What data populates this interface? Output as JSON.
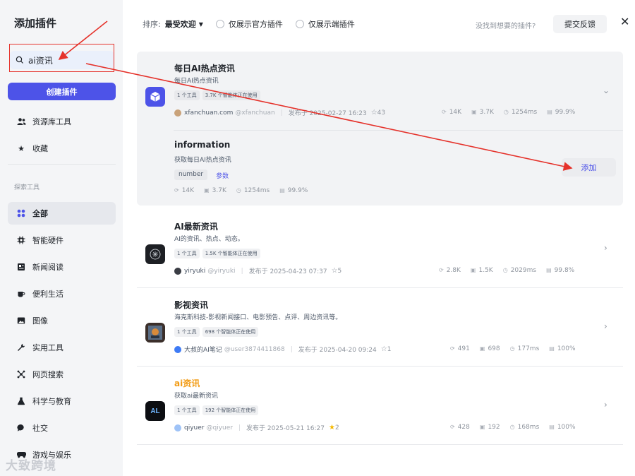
{
  "sidebar": {
    "title": "添加插件",
    "search_value": "ai资讯",
    "create_label": "创建插件",
    "items": [
      {
        "label": "资源库工具",
        "icon": "users-icon"
      },
      {
        "label": "收藏",
        "icon": "star-icon"
      }
    ],
    "section_label": "探索工具",
    "categories": [
      {
        "label": "全部",
        "icon": "grid-icon",
        "active": true
      },
      {
        "label": "智能硬件",
        "icon": "chip-icon"
      },
      {
        "label": "新闻阅读",
        "icon": "news-icon"
      },
      {
        "label": "便利生活",
        "icon": "cup-icon"
      },
      {
        "label": "图像",
        "icon": "image-icon"
      },
      {
        "label": "实用工具",
        "icon": "wrench-icon"
      },
      {
        "label": "网页搜索",
        "icon": "network-icon"
      },
      {
        "label": "科学与教育",
        "icon": "flask-icon"
      },
      {
        "label": "社交",
        "icon": "chat-icon"
      },
      {
        "label": "游戏与娱乐",
        "icon": "gamepad-icon"
      }
    ]
  },
  "watermark": "大致跨境",
  "toolbar": {
    "sort_label": "排序:",
    "sort_value": "最受欢迎",
    "filter_official": "仅展示官方插件",
    "filter_client": "仅展示端插件",
    "no_find_text": "没找到想要的插件?",
    "feedback_label": "提交反馈",
    "close_icon": "close-icon"
  },
  "plugins": [
    {
      "name": "每日AI热点资讯",
      "desc": "每日AI热点资讯",
      "tags": [
        "1 个工具",
        "3.7K 个智能体正在使用"
      ],
      "author": "xfanchuan.com",
      "handle": "@xfanchuan",
      "published": "发布于 2025-02-27 16:23",
      "stars": "43",
      "stats": {
        "calls": "14K",
        "bots": "3.7K",
        "latency": "1254ms",
        "success": "99.9%"
      },
      "tool": {
        "name": "information",
        "desc": "获取每日AI热点资讯",
        "param_tag": "number",
        "param_label": "参数",
        "stats": {
          "calls": "14K",
          "bots": "3.7K",
          "latency": "1254ms",
          "success": "99.9%"
        },
        "add_label": "添加"
      }
    },
    {
      "name": "AI最新资讯",
      "desc": "AI的资讯、热点、动态。",
      "tags": [
        "1 个工具",
        "1.5K 个智能体正在使用"
      ],
      "author": "yiryuki",
      "handle": "@yiryuki",
      "published": "发布于 2025-04-23 07:37",
      "stars": "5",
      "stats": {
        "calls": "2.8K",
        "bots": "1.5K",
        "latency": "2029ms",
        "success": "99.8%"
      }
    },
    {
      "name": "影视资讯",
      "desc": "海克斯科技-影视新闻接口、电影预告、点评、周边资讯等。",
      "tags": [
        "1 个工具",
        "698 个智能体正在使用"
      ],
      "author": "大叔的AI笔记",
      "handle": "@user3874411868",
      "published": "发布于 2025-04-20 09:24",
      "stars": "1",
      "stats": {
        "calls": "491",
        "bots": "698",
        "latency": "177ms",
        "success": "100%"
      }
    },
    {
      "name": "ai资讯",
      "desc": "获取ai最新资讯",
      "tags": [
        "1 个工具",
        "192 个智能体正在使用"
      ],
      "author": "qiyuer",
      "handle": "@qiyuer",
      "published": "发布于 2025-05-21 16:27",
      "stars": "2",
      "stats": {
        "calls": "428",
        "bots": "192",
        "latency": "168ms",
        "success": "100%"
      }
    }
  ],
  "colors": {
    "accent": "#4d53e8",
    "highlight_name": "#f29b13",
    "annotation_red": "#e5322b"
  }
}
